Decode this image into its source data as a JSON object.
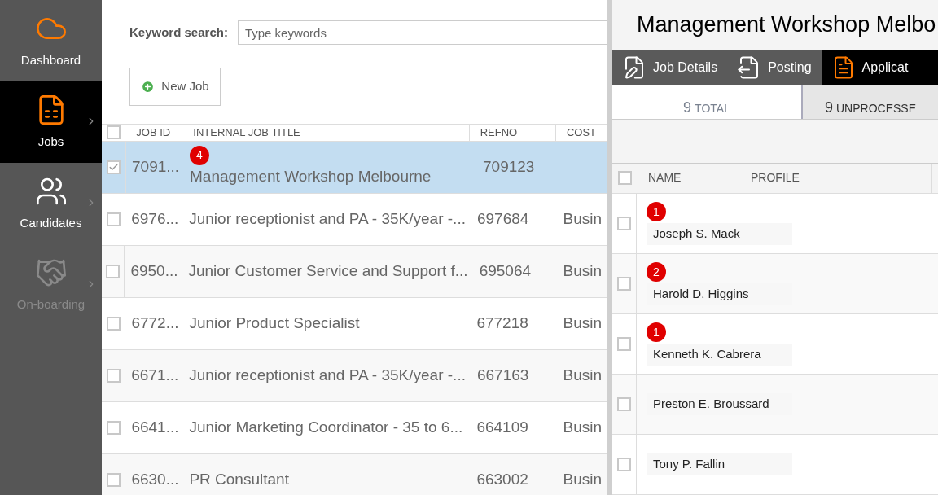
{
  "sidebar": {
    "items": [
      {
        "label": "Dashboard",
        "selected": false,
        "disabled": false
      },
      {
        "label": "Jobs",
        "selected": true,
        "disabled": false
      },
      {
        "label": "Candidates",
        "selected": false,
        "disabled": false
      },
      {
        "label": "On-boarding",
        "selected": false,
        "disabled": true
      }
    ]
  },
  "search": {
    "label": "Keyword search:",
    "placeholder": "Type keywords"
  },
  "new_job_button": "New Job",
  "jobs_table": {
    "all_checked": false,
    "columns": [
      "JOB ID",
      "INTERNAL JOB TITLE",
      "REFNO",
      "COST"
    ],
    "rows": [
      {
        "checked": true,
        "selected": true,
        "badge": "4",
        "cells": [
          "7091...",
          "Management Workshop Melbourne",
          "709123",
          ""
        ]
      },
      {
        "checked": false,
        "selected": false,
        "cells": [
          "6976...",
          "Junior receptionist and PA - 35K/year -...",
          "697684",
          "Busin"
        ]
      },
      {
        "checked": false,
        "selected": false,
        "cells": [
          "6950...",
          "Junior Customer Service and Support f...",
          "695064",
          "Busin"
        ]
      },
      {
        "checked": false,
        "selected": false,
        "cells": [
          "6772...",
          "Junior Product Specialist",
          "677218",
          "Busin"
        ]
      },
      {
        "checked": false,
        "selected": false,
        "cells": [
          "6671...",
          "Junior receptionist and PA - 35K/year -...",
          "667163",
          "Busin"
        ]
      },
      {
        "checked": false,
        "selected": false,
        "cells": [
          "6641...",
          "Junior Marketing Coordinator - 35 to 6...",
          "664109",
          "Busin"
        ]
      },
      {
        "checked": false,
        "selected": false,
        "cells": [
          "6630...",
          "PR Consultant",
          "663002",
          "Busin"
        ]
      }
    ]
  },
  "detail": {
    "title": "Management Workshop Melbo",
    "tabs": [
      {
        "label": "Job Details",
        "selected": false
      },
      {
        "label": "Posting",
        "selected": false
      },
      {
        "label": "Applicat",
        "selected": true
      }
    ],
    "counts": [
      {
        "number": "9",
        "label": "TOTAL",
        "selected": true
      },
      {
        "number": "9",
        "label": "UNPROCESSE",
        "selected": false
      }
    ],
    "all_checked": false,
    "columns": [
      "NAME",
      "PROFILE"
    ],
    "candidates": [
      {
        "name": "Joseph S. Mack",
        "badge": "1",
        "checked": false
      },
      {
        "name": "Harold D. Higgins",
        "badge": "2",
        "checked": false
      },
      {
        "name": "Kenneth K. Cabrera",
        "badge": "1",
        "checked": false
      },
      {
        "name": "Preston E. Broussard",
        "checked": false
      },
      {
        "name": "Tony P. Fallin",
        "checked": false
      }
    ]
  }
}
